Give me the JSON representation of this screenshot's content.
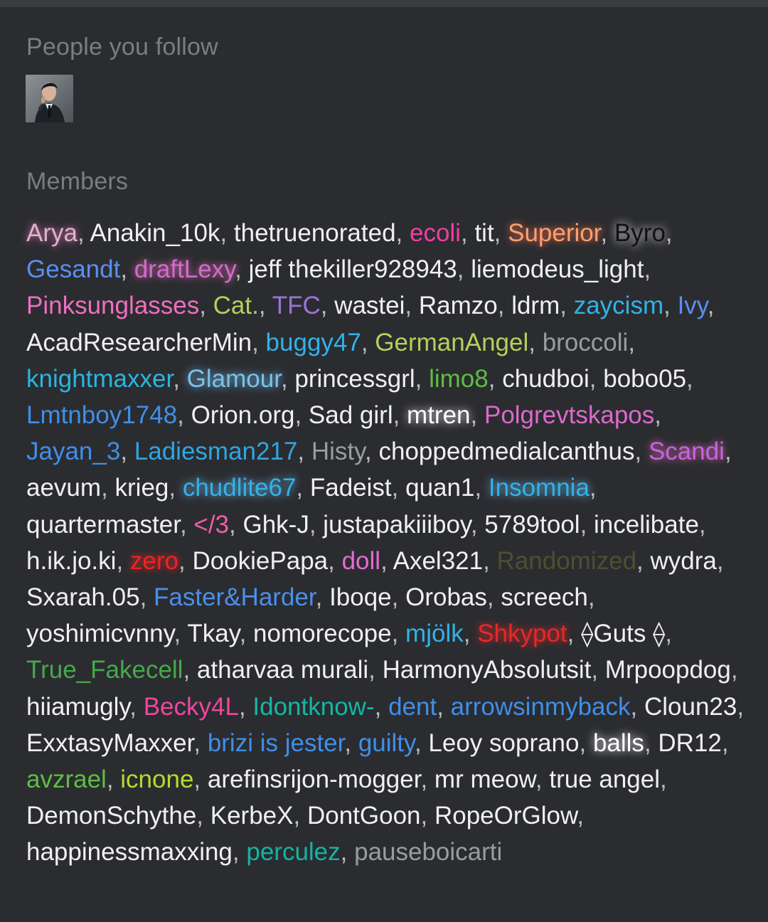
{
  "following": {
    "title": "People you follow"
  },
  "members": {
    "title": "Members",
    "list": [
      {
        "name": "Arya",
        "color": "#d7b6c8",
        "glow": "glow-pink"
      },
      {
        "name": "Anakin_10k",
        "color": "#f0f0f0"
      },
      {
        "name": "thetruenorated",
        "color": "#f0f0f0"
      },
      {
        "name": "ecoli",
        "color": "#f03fa0"
      },
      {
        "name": "tit",
        "color": "#f0f0f0"
      },
      {
        "name": "Superior",
        "color": "#ffa06e",
        "glow": "glow-orange"
      },
      {
        "name": "Byro",
        "color": "#111111",
        "glow": "glow-white"
      },
      {
        "name": "Gesandt",
        "color": "#5b8ef0"
      },
      {
        "name": "draftLexy",
        "color": "#d36bd0",
        "glow": "glow-pink"
      },
      {
        "name": "jeff thekiller928943",
        "color": "#f0f0f0"
      },
      {
        "name": "liemodeus_light",
        "color": "#f0f0f0"
      },
      {
        "name": "Pinksunglasses",
        "color": "#ee6fc0"
      },
      {
        "name": "Cat.",
        "color": "#b7cf5b"
      },
      {
        "name": "TFC",
        "color": "#9a73d8"
      },
      {
        "name": "wastei",
        "color": "#f0f0f0"
      },
      {
        "name": "Ramzo",
        "color": "#f0f0f0"
      },
      {
        "name": "ldrm",
        "color": "#f0f0f0"
      },
      {
        "name": "zaycism",
        "color": "#2fb3e8"
      },
      {
        "name": "Ivy",
        "color": "#5b8ef0"
      },
      {
        "name": "AcadResearcherMin",
        "color": "#f0f0f0"
      },
      {
        "name": "buggy47",
        "color": "#2fb3e8"
      },
      {
        "name": "GermanAngel",
        "color": "#b7cf5b"
      },
      {
        "name": "broccoli",
        "color": "#9a9ca0"
      },
      {
        "name": "knightmaxxer",
        "color": "#29b6df"
      },
      {
        "name": "Glamour",
        "color": "#79c2ea",
        "glow": "glow-blue"
      },
      {
        "name": "princessgrl",
        "color": "#f0f0f0"
      },
      {
        "name": "limo8",
        "color": "#5fbd44"
      },
      {
        "name": "chudboi",
        "color": "#f0f0f0"
      },
      {
        "name": "bobo05",
        "color": "#f0f0f0"
      },
      {
        "name": "Lmtnboy1748",
        "color": "#3f8fe8"
      },
      {
        "name": "Orion.org",
        "color": "#f0f0f0"
      },
      {
        "name": "Sad girl",
        "color": "#f0f0f0"
      },
      {
        "name": "mtren",
        "color": "#ffffff",
        "glow": "glow-white"
      },
      {
        "name": "Polgrevtskapos",
        "color": "#dc69cc"
      },
      {
        "name": "Jayan_3",
        "color": "#3f8fe8"
      },
      {
        "name": "Ladiesman217",
        "color": "#2fa6e3"
      },
      {
        "name": "Histy",
        "color": "#9a9ca0"
      },
      {
        "name": "choppedmedialcanthus",
        "color": "#f0f0f0"
      },
      {
        "name": "Scandi",
        "color": "#c663e2",
        "glow": "glow-pink"
      },
      {
        "name": "aevum",
        "color": "#f0f0f0"
      },
      {
        "name": "krieg",
        "color": "#f0f0f0"
      },
      {
        "name": "chudlite67",
        "color": "#2fb3e8",
        "glow": "glow-blue"
      },
      {
        "name": "Fadeist",
        "color": "#f0f0f0"
      },
      {
        "name": "quan1",
        "color": "#f0f0f0"
      },
      {
        "name": "Insomnia",
        "color": "#2fb3e8",
        "glow": "glow-blue"
      },
      {
        "name": "quartermaster",
        "color": "#f0f0f0"
      },
      {
        "name": "</3",
        "color": "#ee5fa4"
      },
      {
        "name": "Ghk-J",
        "color": "#f0f0f0"
      },
      {
        "name": "justapakiiiboy",
        "color": "#f0f0f0"
      },
      {
        "name": "5789tool",
        "color": "#f0f0f0"
      },
      {
        "name": "incelibate",
        "color": "#f0f0f0"
      },
      {
        "name": "h.ik.jo.ki",
        "color": "#f0f0f0"
      },
      {
        "name": "zero",
        "color": "#ef2222",
        "glow": "glow-red"
      },
      {
        "name": "DookiePapa",
        "color": "#f0f0f0"
      },
      {
        "name": "doll",
        "color": "#e86ad4"
      },
      {
        "name": "Axel321",
        "color": "#f0f0f0"
      },
      {
        "name": "Randomized",
        "color": "#4e4f2f"
      },
      {
        "name": "wydra",
        "color": "#f0f0f0"
      },
      {
        "name": "Sxarah.05",
        "color": "#f0f0f0"
      },
      {
        "name": "Faster&Harder",
        "color": "#4b8fea"
      },
      {
        "name": "Iboqe",
        "color": "#f0f0f0"
      },
      {
        "name": "Orobas",
        "color": "#f0f0f0"
      },
      {
        "name": "screech",
        "color": "#f0f0f0"
      },
      {
        "name": "yoshimicvnny",
        "color": "#f0f0f0"
      },
      {
        "name": "Tkay",
        "color": "#f0f0f0"
      },
      {
        "name": "nomorecope",
        "color": "#f0f0f0"
      },
      {
        "name": "mjölk",
        "color": "#2fb3e8"
      },
      {
        "name": "Shkypot",
        "color": "#e62828",
        "glow": "glow-red"
      },
      {
        "name": "⟠Guts ⟠",
        "color": "#f0f0f0"
      },
      {
        "name": "True_Fakecell",
        "color": "#45a94a"
      },
      {
        "name": "atharvaa murali",
        "color": "#f0f0f0"
      },
      {
        "name": "HarmonyAbsolutsit",
        "color": "#f0f0f0"
      },
      {
        "name": "Mrpoopdog",
        "color": "#f0f0f0"
      },
      {
        "name": "hiiamugly",
        "color": "#f0f0f0"
      },
      {
        "name": "Becky4L",
        "color": "#ef46a0"
      },
      {
        "name": "Idontknow-",
        "color": "#14b7a6"
      },
      {
        "name": "dent",
        "color": "#3f8fe8"
      },
      {
        "name": "arrowsinmyback",
        "color": "#3f8fe8"
      },
      {
        "name": "Cloun23",
        "color": "#f0f0f0"
      },
      {
        "name": "ExxtasyMaxxer",
        "color": "#f0f0f0"
      },
      {
        "name": "brizi is jester",
        "color": "#3f8fe8"
      },
      {
        "name": "guilty",
        "color": "#3f8fe8"
      },
      {
        "name": "Leoy soprano",
        "color": "#f0f0f0"
      },
      {
        "name": "balls",
        "color": "#ffffff",
        "glow": "glow-white"
      },
      {
        "name": "DR12",
        "color": "#f0f0f0"
      },
      {
        "name": "avzrael",
        "color": "#5fbd44"
      },
      {
        "name": "icnone",
        "color": "#b4dc2f"
      },
      {
        "name": "arefinsrijon-mogger",
        "color": "#f0f0f0"
      },
      {
        "name": "mr meow",
        "color": "#f0f0f0"
      },
      {
        "name": "true angel",
        "color": "#f0f0f0"
      },
      {
        "name": "DemonSchythe",
        "color": "#f0f0f0"
      },
      {
        "name": "KerbeX",
        "color": "#f0f0f0"
      },
      {
        "name": "DontGoon",
        "color": "#f0f0f0"
      },
      {
        "name": "RopeOrGlow",
        "color": "#f0f0f0"
      },
      {
        "name": "happinessmaxxing",
        "color": "#f0f0f0"
      },
      {
        "name": "perculez",
        "color": "#16b3a3"
      },
      {
        "name": "pauseboicarti",
        "color": "#9a9ca0"
      }
    ]
  }
}
